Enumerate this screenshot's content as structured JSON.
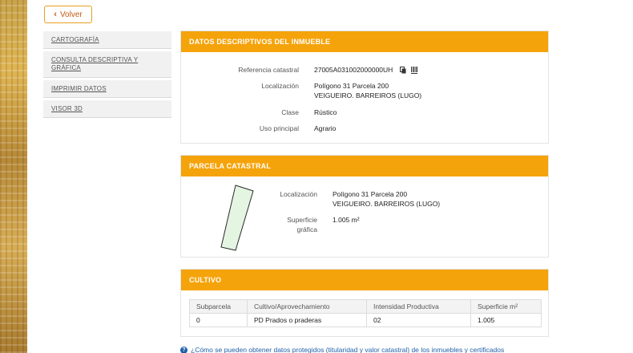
{
  "back_button": {
    "label": "Volver"
  },
  "sidebar": {
    "items": [
      {
        "label": "CARTOGRAFÍA"
      },
      {
        "label": "CONSULTA DESCRIPTIVA Y GRÁFICA"
      },
      {
        "label": "IMPRIMIR DATOS"
      },
      {
        "label": "VISOR 3D"
      }
    ]
  },
  "descriptive": {
    "title": "DATOS DESCRIPTIVOS DEL INMUEBLE",
    "ref_label": "Referencia catastral",
    "ref_value": "27005A031002000000UH",
    "loc_label": "Localización",
    "loc_line1": "Polígono 31 Parcela 200",
    "loc_line2": "VEIGUEIRO. BARREIROS (LUGO)",
    "class_label": "Clase",
    "class_value": "Rústico",
    "use_label": "Uso principal",
    "use_value": "Agrario",
    "icons": [
      "copy-icon",
      "barcode-icon"
    ]
  },
  "parcel": {
    "title": "PARCELA CATASTRAL",
    "loc_label": "Localización",
    "loc_line1": "Polígono 31 Parcela 200",
    "loc_line2": "VEIGUEIRO. BARREIROS (LUGO)",
    "surface_label_1": "Superficie",
    "surface_label_2": "gráfica",
    "surface_value": "1.005 m²"
  },
  "crop": {
    "title": "CULTIVO",
    "columns": [
      "Subparcela",
      "Cultivo/Aprovechamiento",
      "Intensidad Productiva",
      "Superficie m²"
    ],
    "rows": [
      [
        "0",
        "PD Prados o praderas",
        "02",
        "1.005"
      ]
    ]
  },
  "footer": {
    "link_text": "¿Cómo se pueden obtener datos protegidos (titularidad y valor catastral) de los inmuebles y certificados"
  },
  "colors": {
    "accent": "#f5a30a",
    "link": "#1f5fa8",
    "parcel_fill": "#e4f5e2"
  }
}
